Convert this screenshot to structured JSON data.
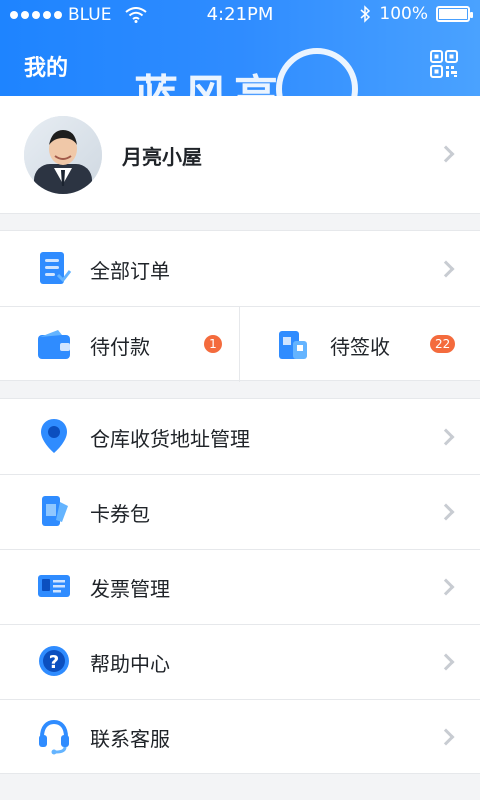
{
  "status_bar": {
    "carrier": "BLUE",
    "time": "4:21PM",
    "battery": "100%"
  },
  "header": {
    "title": "我的",
    "brand_partial": "蓝风高",
    "qr_icon": "qr-code-icon"
  },
  "profile": {
    "name": "月亮小屋",
    "avatar_icon": "profile-photo"
  },
  "orders": {
    "all_label": "全部订单",
    "pending_payment_label": "待付款",
    "pending_payment_count": "1",
    "pending_receipt_label": "待签收",
    "pending_receipt_count": "22"
  },
  "menu": [
    {
      "label": "仓库收货地址管理",
      "icon": "location-pin-icon"
    },
    {
      "label": "卡券包",
      "icon": "coupon-icon"
    },
    {
      "label": "发票管理",
      "icon": "invoice-card-icon"
    },
    {
      "label": "帮助中心",
      "icon": "help-question-icon"
    },
    {
      "label": "联系客服",
      "icon": "headset-icon"
    }
  ],
  "colors": {
    "brand_blue": "#1e84ff",
    "badge_orange": "#f46b3d",
    "background": "#f3f4f6"
  }
}
